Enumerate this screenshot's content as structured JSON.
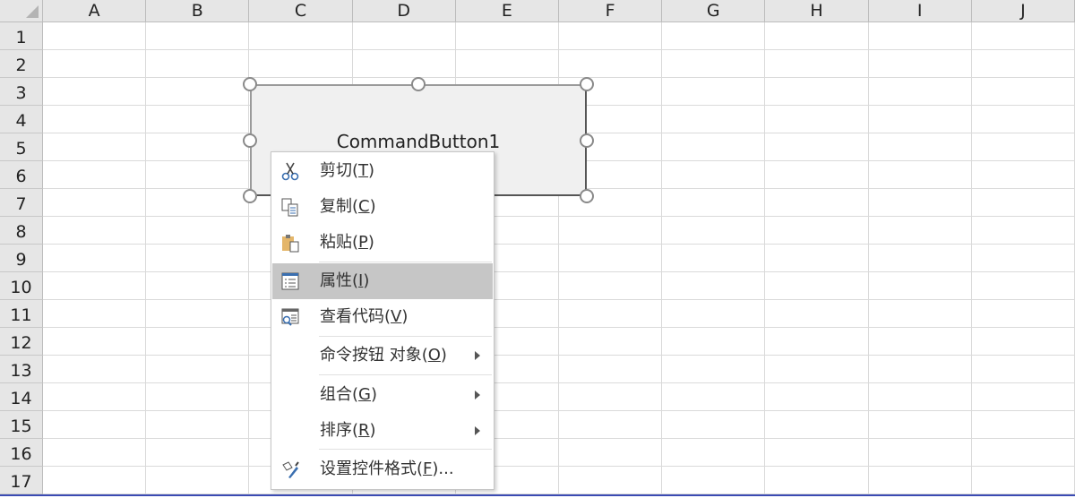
{
  "columns": [
    "A",
    "B",
    "C",
    "D",
    "E",
    "F",
    "G",
    "H",
    "I",
    "J"
  ],
  "rows": [
    "1",
    "2",
    "3",
    "4",
    "5",
    "6",
    "7",
    "8",
    "9",
    "10",
    "11",
    "12",
    "13",
    "14",
    "15",
    "16",
    "17"
  ],
  "button": {
    "caption": "CommandButton1"
  },
  "menu": {
    "items": [
      {
        "pre": "剪切(",
        "key": "T",
        "post": ")",
        "icon": "scissors-icon"
      },
      {
        "pre": "复制(",
        "key": "C",
        "post": ")",
        "icon": "copy-icon"
      },
      {
        "pre": "粘贴(",
        "key": "P",
        "post": ")",
        "icon": "paste-icon"
      },
      {
        "pre": "属性(",
        "key": "I",
        "post": ")",
        "icon": "properties-icon",
        "highlighted": true
      },
      {
        "pre": "查看代码(",
        "key": "V",
        "post": ")",
        "icon": "view-code-icon"
      },
      {
        "pre": "命令按钮 对象(",
        "key": "O",
        "post": ")",
        "submenu": true
      },
      {
        "pre": "组合(",
        "key": "G",
        "post": ")",
        "submenu": true
      },
      {
        "pre": "排序(",
        "key": "R",
        "post": ")",
        "submenu": true
      },
      {
        "pre": "设置控件格式(",
        "key": "F",
        "post": ")...",
        "icon": "format-control-icon"
      }
    ]
  }
}
